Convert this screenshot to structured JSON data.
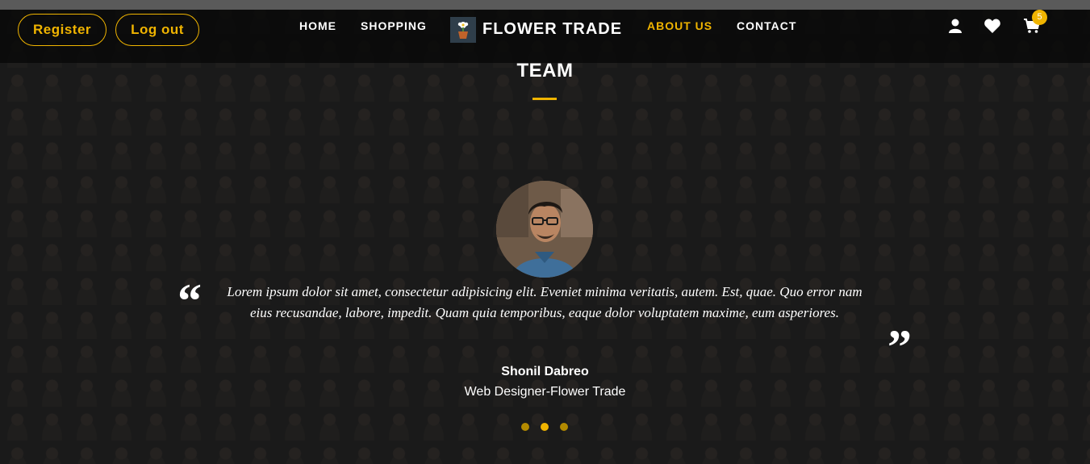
{
  "header": {
    "register_label": "Register",
    "logout_label": "Log out",
    "nav": [
      {
        "label": "HOME"
      },
      {
        "label": "SHOPPING"
      },
      {
        "label": "ABOUT US"
      },
      {
        "label": "CONTACT"
      }
    ],
    "active_nav": "ABOUT US",
    "brand": "FLOWER TRADE",
    "cart_count": "5",
    "icons": [
      "user-icon",
      "heart-icon",
      "cart-icon"
    ]
  },
  "team": {
    "title": "TEAM",
    "testimonial": {
      "text": "Lorem ipsum dolor sit amet, consectetur adipisicing elit. Eveniet minima veritatis, autem. Est, quae. Quo error nam eius recusandae, labore, impedit. Quam quia temporibus, eaque dolor voluptatem maxime, eum asperiores.",
      "name": "Shonil Dabreo",
      "role": "Web Designer-Flower Trade"
    },
    "carousel": {
      "count": 3,
      "active_index": 1
    }
  },
  "colors": {
    "accent": "#f0b400",
    "navbar": "#080808",
    "text": "#ffffff"
  }
}
